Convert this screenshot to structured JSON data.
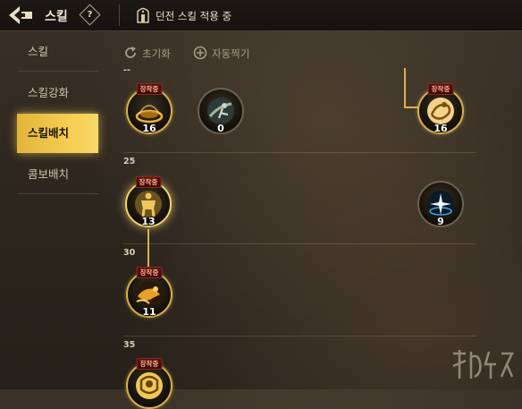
{
  "header": {
    "title": "스킬",
    "help_label": "?",
    "dungeon_status": "던전 스킬 적용 중"
  },
  "sidebar": {
    "items": [
      {
        "label": "스킬",
        "active": false
      },
      {
        "label": "스킬강화",
        "active": false
      },
      {
        "label": "스킬배치",
        "active": true
      },
      {
        "label": "콤보배치",
        "active": false
      }
    ]
  },
  "actions": {
    "reset_label": "초기화",
    "auto_label": "자동찍기"
  },
  "tiers": [
    {
      "label": "--"
    },
    {
      "label": "25"
    },
    {
      "label": "30"
    },
    {
      "label": "35"
    }
  ],
  "skills": [
    {
      "name": "golden-aura",
      "icon": "ring-aura-icon",
      "badge": "장착중",
      "level": "16"
    },
    {
      "name": "wind-slash",
      "icon": "sweep-figure-icon",
      "badge": "",
      "level": "0"
    },
    {
      "name": "whirl-kick",
      "icon": "spin-figure-icon",
      "badge": "장착중",
      "level": "16"
    },
    {
      "name": "power-stance",
      "icon": "muscle-figure-icon",
      "badge": "장착중",
      "level": "13"
    },
    {
      "name": "star-burst",
      "icon": "star-burst-icon",
      "badge": "",
      "level": "9"
    },
    {
      "name": "flame-charge",
      "icon": "charge-figure-icon",
      "badge": "장착중",
      "level": "11"
    },
    {
      "name": "fist-guard",
      "icon": "fist-icon",
      "badge": "장착중",
      "level": ""
    }
  ],
  "colors": {
    "accent": "#f4cc52",
    "badge_bg": "#5a1010",
    "badge_text": "#ffb08a",
    "ring": "#d9b04a"
  }
}
